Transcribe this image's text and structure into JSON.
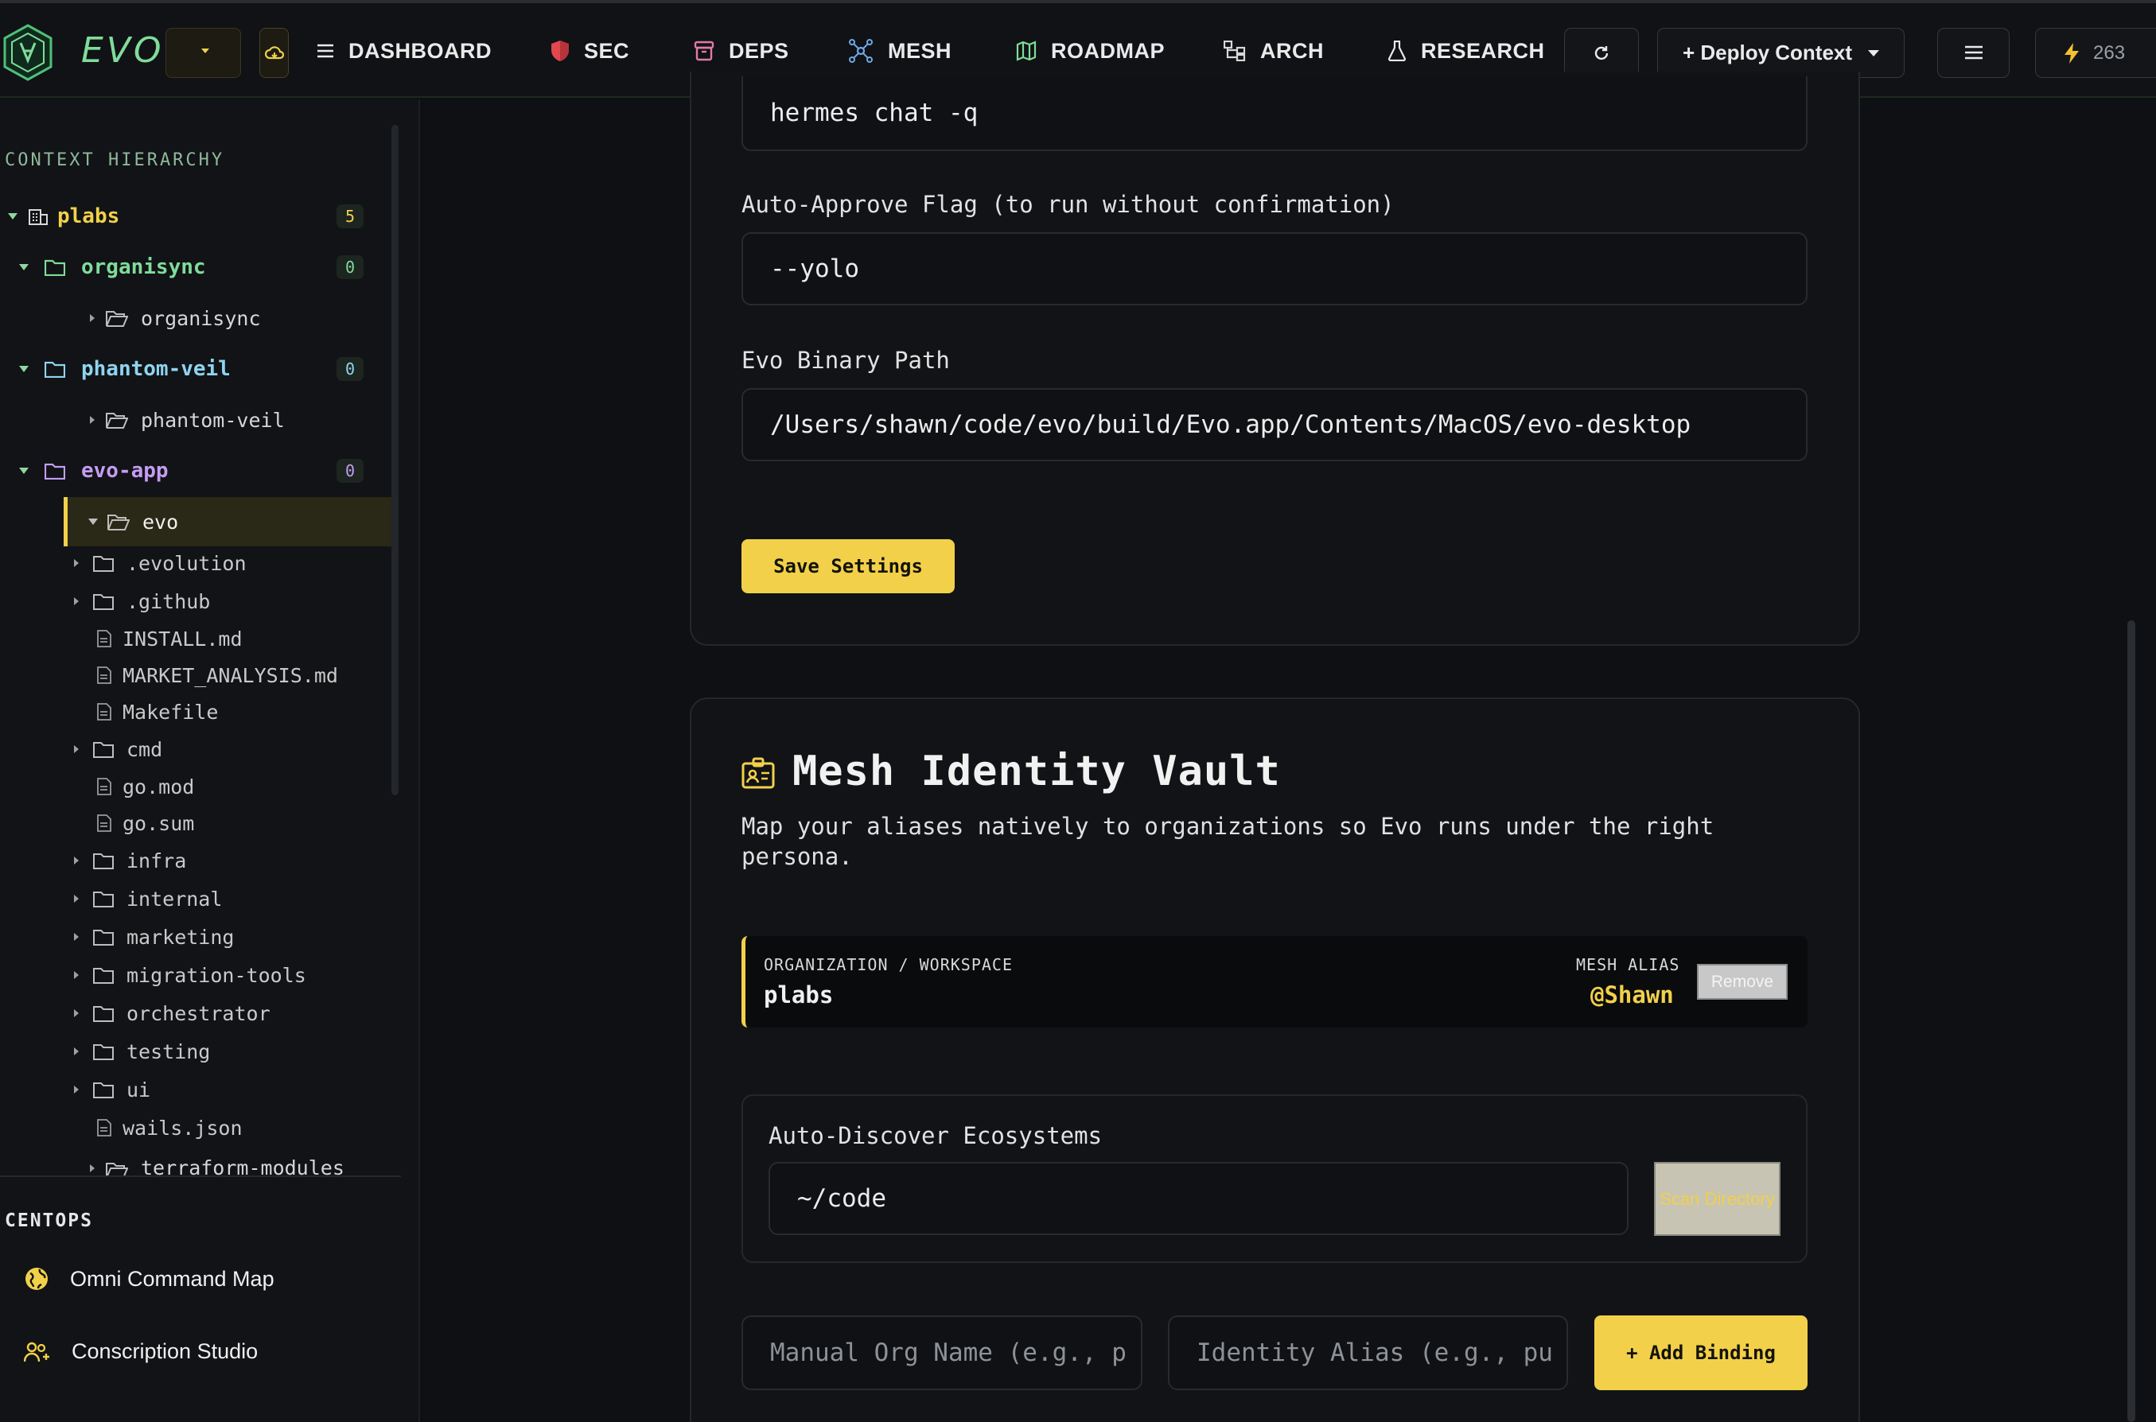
{
  "app": {
    "brand": "EVO",
    "energy_count": "263"
  },
  "nav": [
    {
      "label": "DASHBOARD",
      "icon": "menu-lines-icon"
    },
    {
      "label": "SEC",
      "icon": "shield-icon"
    },
    {
      "label": "DEPS",
      "icon": "archive-box-icon"
    },
    {
      "label": "MESH",
      "icon": "network-icon"
    },
    {
      "label": "ROADMAP",
      "icon": "map-icon"
    },
    {
      "label": "ARCH",
      "icon": "hierarchy-icon"
    },
    {
      "label": "RESEARCH",
      "icon": "flask-icon",
      "active": true
    }
  ],
  "toolbar": {
    "deploy_label": "+ Deploy Context"
  },
  "sidebar": {
    "title": "CONTEXT HIERARCHY",
    "root": {
      "label": "plabs",
      "count": "5"
    },
    "groups": [
      {
        "label": "organisync",
        "count": "0",
        "child": "organisync",
        "color": "#7fdc9a"
      },
      {
        "label": "phantom-veil",
        "count": "0",
        "child": "phantom-veil",
        "color": "#8fd4ef"
      },
      {
        "label": "evo-app",
        "count": "0",
        "child": "evo",
        "color": "#c49cf2"
      }
    ],
    "files": [
      {
        "name": ".evolution",
        "type": "folder"
      },
      {
        "name": ".github",
        "type": "folder"
      },
      {
        "name": "INSTALL.md",
        "type": "file"
      },
      {
        "name": "MARKET_ANALYSIS.md",
        "type": "file"
      },
      {
        "name": "Makefile",
        "type": "file"
      },
      {
        "name": "cmd",
        "type": "folder"
      },
      {
        "name": "go.mod",
        "type": "file"
      },
      {
        "name": "go.sum",
        "type": "file"
      },
      {
        "name": "infra",
        "type": "folder"
      },
      {
        "name": "internal",
        "type": "folder"
      },
      {
        "name": "marketing",
        "type": "folder"
      },
      {
        "name": "migration-tools",
        "type": "folder"
      },
      {
        "name": "orchestrator",
        "type": "folder"
      },
      {
        "name": "testing",
        "type": "folder"
      },
      {
        "name": "ui",
        "type": "folder"
      },
      {
        "name": "wails.json",
        "type": "file"
      }
    ],
    "partial_item": "terraform-modules",
    "centops_title": "CENTOPS",
    "links": [
      {
        "label": "Omni Command Map",
        "icon": "globe-icon"
      },
      {
        "label": "Conscription Studio",
        "icon": "user-add-icon"
      }
    ]
  },
  "settings": {
    "command_value": "hermes chat -q",
    "auto_approve_label": "Auto-Approve Flag (to run without confirmation)",
    "auto_approve_value": "--yolo",
    "binary_label": "Evo Binary Path",
    "binary_value": "/Users/shawn/code/evo/build/Evo.app/Contents/MacOS/evo-desktop",
    "save_label": "Save Settings"
  },
  "vault": {
    "title": "Mesh Identity Vault",
    "subtitle": "Map your aliases natively to organizations so Evo runs under the right persona.",
    "org_header": "ORGANIZATION / WORKSPACE",
    "alias_header": "MESH ALIAS",
    "binding_org": "plabs",
    "binding_alias": "@Shawn",
    "remove_label": "Remove",
    "discover_label": "Auto-Discover Ecosystems",
    "discover_value": "~/code",
    "scan_label": "Scan Directory",
    "org_placeholder": "Manual Org Name (e.g., p",
    "alias_placeholder": "Identity Alias (e.g., pu",
    "add_label": "+ Add Binding"
  },
  "colors": {
    "accent": "#f2d04a",
    "brand_green": "#7fdc9a",
    "background": "#0e1013"
  }
}
